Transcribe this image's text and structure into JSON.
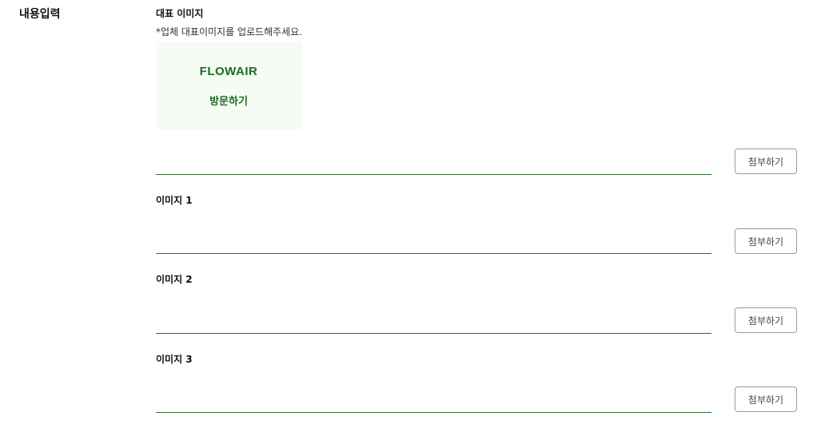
{
  "section": {
    "title": "내용입력"
  },
  "fields": [
    {
      "label": "대표 이미지",
      "help": "*업체 대표이미지를 업로드해주세요.",
      "preview": {
        "brand": "FLOWAIR",
        "cta": "방문하기"
      },
      "value": "",
      "button": "첨부하기"
    },
    {
      "label": "이미지 1",
      "value": "",
      "button": "첨부하기"
    },
    {
      "label": "이미지 2",
      "value": "",
      "button": "첨부하기"
    },
    {
      "label": "이미지 3",
      "value": "",
      "button": "첨부하기"
    }
  ],
  "colors": {
    "accent": "#1e6a22",
    "preview_bg": "#f5fcf3",
    "underline": "#2f6e2f"
  }
}
